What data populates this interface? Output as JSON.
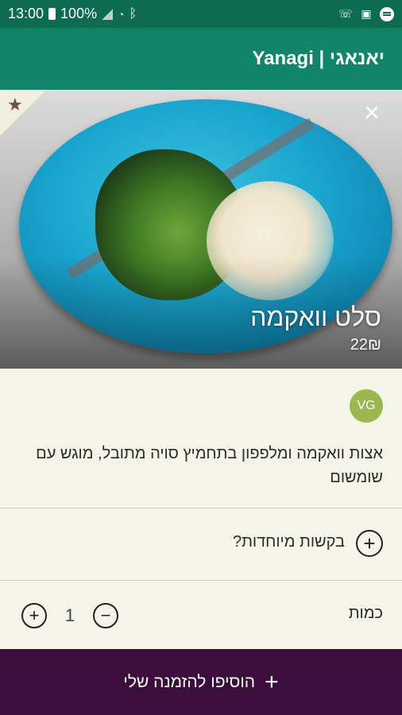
{
  "status_bar": {
    "time": "13:00",
    "battery": "100%",
    "icons": [
      "battery-icon",
      "signal-icon",
      "wifi-icon",
      "bluetooth-icon",
      "call-forward-icon",
      "photo-icon",
      "spotify-icon"
    ]
  },
  "app_bar": {
    "title": "Yanagi | יאנאגי",
    "color": "#11856a"
  },
  "dish": {
    "name": "סלט וואקמה",
    "price": "22₪",
    "badge": "VG",
    "badge_color": "#9ab84e",
    "description": "אצות וואקמה ומלפפון בתחמיץ סויה מתובל, מוגש עם שומשום",
    "favorite_icon": "star-icon",
    "close_icon": "close-icon"
  },
  "special_requests": {
    "label": "בקשות מיוחדות?",
    "icon": "plus-circle-icon"
  },
  "quantity": {
    "label": "כמות",
    "value": "1"
  },
  "add_to_order": {
    "label": "הוסיפו להזמנה שלי",
    "color": "#3b0e3d"
  }
}
